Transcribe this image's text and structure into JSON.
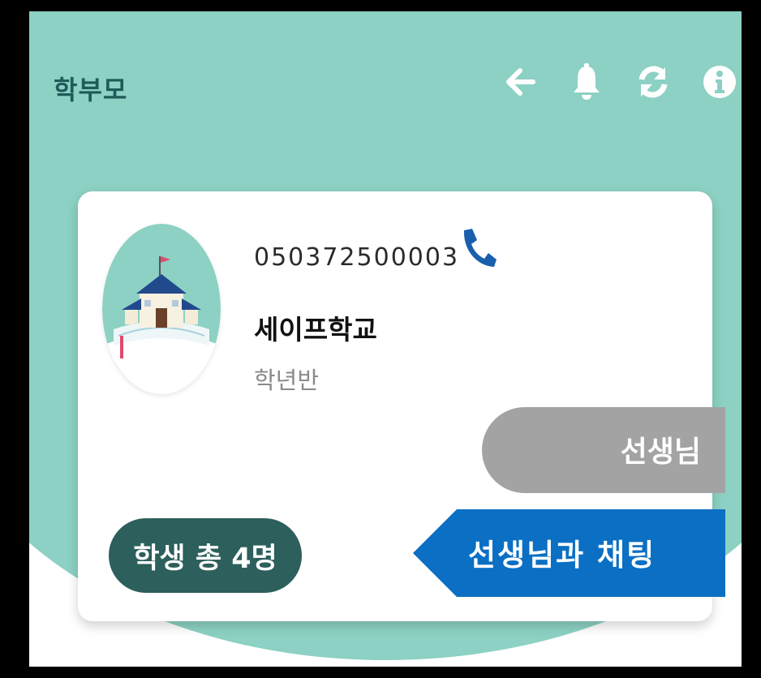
{
  "header": {
    "title": "학부모",
    "icons": [
      "back-arrow-icon",
      "bell-icon",
      "refresh-icon",
      "info-icon"
    ]
  },
  "school": {
    "phone": "050372500003",
    "name": "세이프학교",
    "grade_class": "학년반"
  },
  "teacher_tab": {
    "label": "선생님"
  },
  "chat_tab": {
    "label": "선생님과 채팅"
  },
  "student_count": {
    "label": "학생 총 4명"
  },
  "colors": {
    "teal_bg": "#8cd1c3",
    "dark_teal": "#2d5f5c",
    "chat_blue": "#0b6fc4",
    "teacher_gray": "#a3a3a3",
    "phone_blue": "#1a5fae"
  }
}
